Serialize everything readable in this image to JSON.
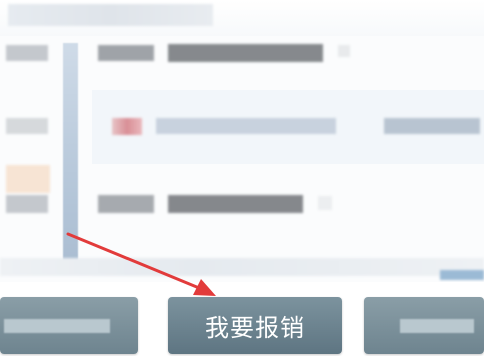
{
  "toolbar": {
    "submit_expense_label": "我要报销"
  },
  "colors": {
    "button_fill": "#6b828e",
    "arrow": "#e23b3b",
    "guide_line": "#b8c9db"
  },
  "icons": {
    "annotation": "red-arrow-icon"
  }
}
